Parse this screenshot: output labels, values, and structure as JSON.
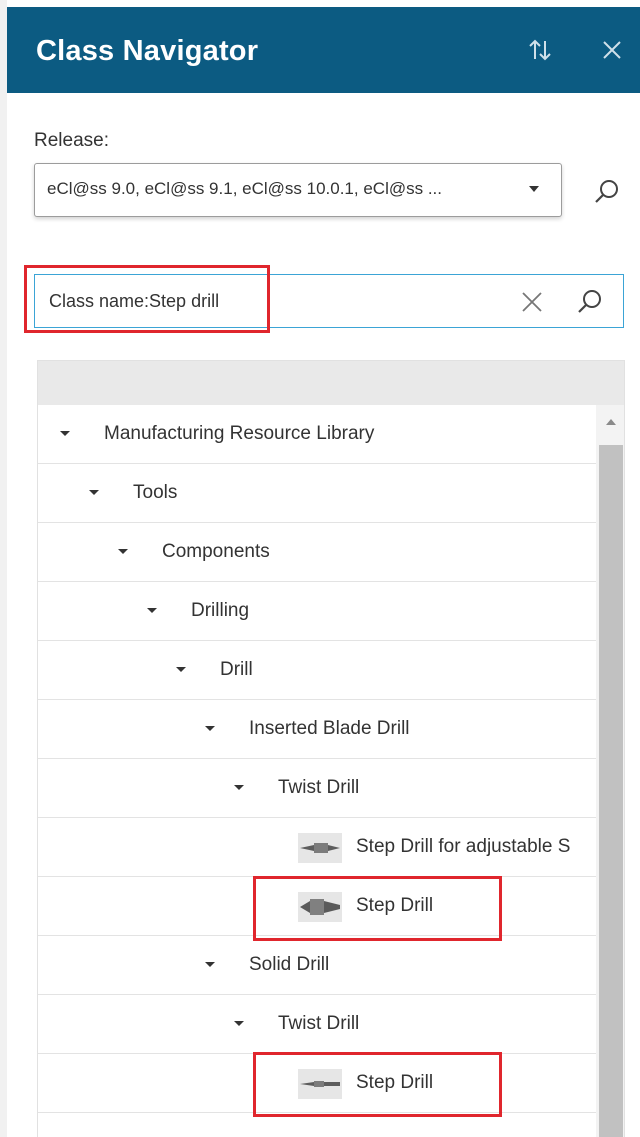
{
  "header": {
    "title": "Class Navigator",
    "sort_icon": "sort-arrows-icon",
    "close_icon": "close-icon",
    "bg_color": "#0c5b82"
  },
  "release": {
    "label": "Release:",
    "value": "eCl@ss 9.0, eCl@ss 9.1, eCl@ss 10.0.1, eCl@ss ..."
  },
  "search": {
    "value": "Class name:Step drill",
    "clear_icon": "close-icon",
    "search_icon": "search-icon"
  },
  "highlight_color": "#e0262d",
  "tree": {
    "items": [
      {
        "label": "Manufacturing Resource Library",
        "expanded": true
      },
      {
        "label": "Tools",
        "expanded": true
      },
      {
        "label": "Components",
        "expanded": true
      },
      {
        "label": "Drilling",
        "expanded": true
      },
      {
        "label": "Drill",
        "expanded": true
      },
      {
        "label": "Inserted Blade Drill",
        "expanded": true
      },
      {
        "label": "Twist Drill",
        "expanded": true
      },
      {
        "label": "Step Drill for adjustable S",
        "leaf": true,
        "thumbnail": "drill-thumbnail"
      },
      {
        "label": "Step Drill",
        "leaf": true,
        "thumbnail": "drill-thumbnail",
        "highlighted": true
      },
      {
        "label": "Solid Drill",
        "expanded": true
      },
      {
        "label": "Twist Drill",
        "expanded": true
      },
      {
        "label": "Step Drill",
        "leaf": true,
        "thumbnail": "drill-thumbnail",
        "highlighted": true
      }
    ]
  }
}
